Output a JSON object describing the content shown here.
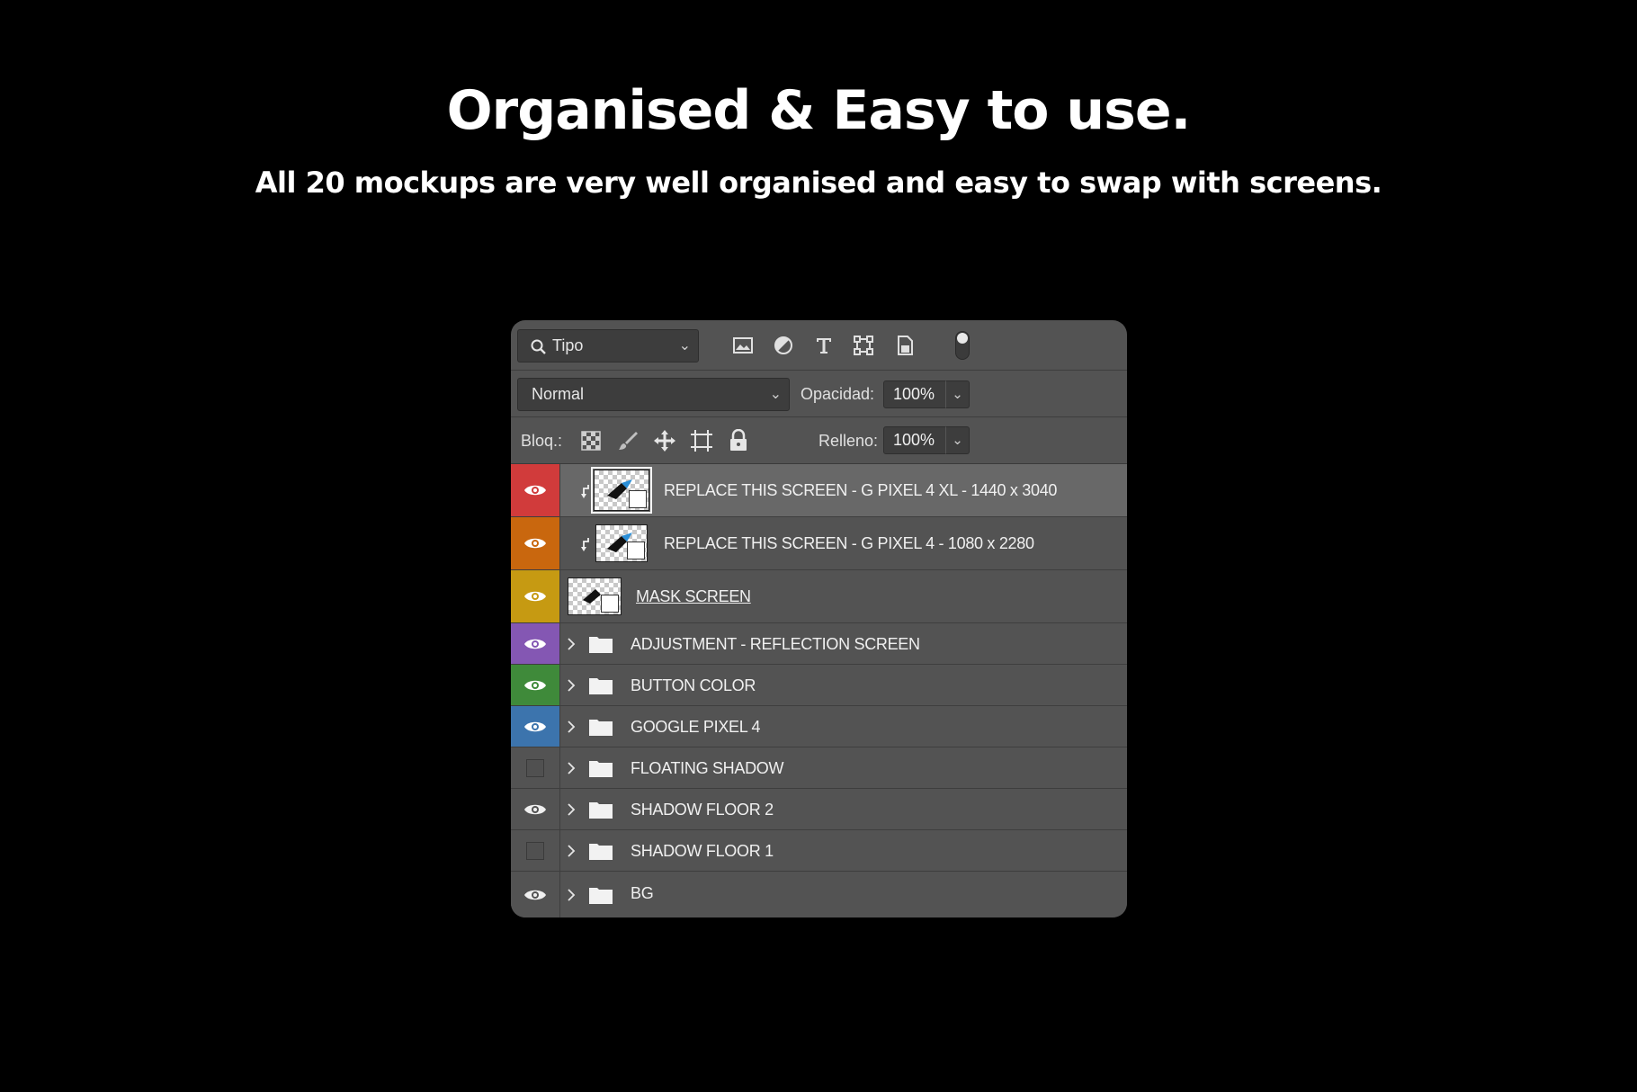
{
  "headline": "Organised & Easy to use.",
  "subline": "All 20 mockups are very well organised and easy to swap with screens.",
  "panel": {
    "filter": {
      "kind_label": "Tipo",
      "icons": [
        "image-filter-icon",
        "adjustment-filter-icon",
        "type-filter-icon",
        "shape-filter-icon",
        "smart-object-filter-icon"
      ],
      "toggle_on": true
    },
    "blend": {
      "mode": "Normal",
      "opacity_label": "Opacidad:",
      "opacity_value": "100%"
    },
    "lock": {
      "label": "Bloq.:",
      "icons": [
        "lock-transparent-icon",
        "lock-paint-icon",
        "lock-position-icon",
        "lock-artboard-icon",
        "lock-all-icon"
      ],
      "fill_label": "Relleno:",
      "fill_value": "100%"
    },
    "layers": [
      {
        "name": "REPLACE THIS SCREEN - G PIXEL 4 XL - 1440 x 3040",
        "color": "#d13b3b",
        "visible": true,
        "kind": "smart-object",
        "clipped": true,
        "selected": true
      },
      {
        "name": "REPLACE THIS SCREEN - G PIXEL 4 - 1080 x 2280",
        "color": "#c9670e",
        "visible": true,
        "kind": "smart-object",
        "clipped": true,
        "selected": false
      },
      {
        "name": "MASK SCREEN",
        "color": "#c69a12",
        "visible": true,
        "kind": "shape",
        "clipped": false,
        "selected": false
      },
      {
        "name": "ADJUSTMENT - REFLECTION SCREEN",
        "color": "#8457b3",
        "visible": true,
        "kind": "group",
        "selected": false
      },
      {
        "name": "BUTTON COLOR",
        "color": "#3f8a3a",
        "visible": true,
        "kind": "group",
        "selected": false
      },
      {
        "name": "GOOGLE PIXEL 4",
        "color": "#3c74ad",
        "visible": true,
        "kind": "group",
        "selected": false
      },
      {
        "name": "FLOATING SHADOW",
        "color": "none",
        "visible": false,
        "kind": "group",
        "selected": false
      },
      {
        "name": "SHADOW FLOOR 2",
        "color": "none",
        "visible": true,
        "kind": "group",
        "selected": false
      },
      {
        "name": "SHADOW FLOOR 1",
        "color": "none",
        "visible": false,
        "kind": "group",
        "selected": false
      },
      {
        "name": "BG",
        "color": "none",
        "visible": true,
        "kind": "group",
        "selected": false
      }
    ]
  }
}
